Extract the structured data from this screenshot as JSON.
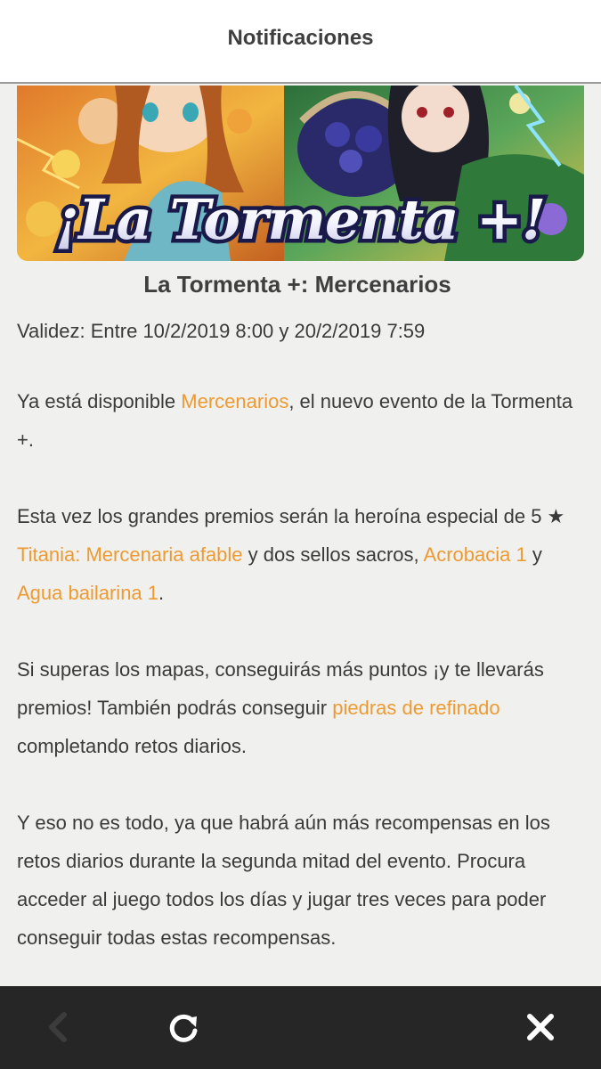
{
  "header": {
    "title": "Notificaciones"
  },
  "banner": {
    "text": "¡La Tormenta +!"
  },
  "article": {
    "title": "La Tormenta +: Mercenarios",
    "validity": "Validez: Entre 10/2/2019 8:00 y 20/2/2019 7:59",
    "p1": {
      "t1": "Ya está disponible ",
      "link_mercenarios": "Mercenarios",
      "t2": ", el nuevo evento de la Tormenta +."
    },
    "p2": {
      "t1": "Esta vez los grandes premios serán la heroína especial de 5 ★ ",
      "link_titania": "Titania: Mercenaria afable",
      "t2": " y dos sellos sacros, ",
      "link_acrobacia": "Acrobacia 1",
      "t3": " y ",
      "link_agua": "Agua bailarina 1",
      "t4": "."
    },
    "p3": {
      "t1": "Si superas los mapas, conseguirás más puntos ¡y te llevarás premios! También podrás conseguir ",
      "link_piedras": "piedras de refinado",
      "t2": " completando retos diarios."
    },
    "p4": {
      "t1": "Y eso no es todo, ya que habrá aún más recompensas en los retos diarios durante la segunda mitad del evento. Procura acceder al juego todos los días y jugar tres veces para poder conseguir todas estas recompensas."
    }
  },
  "footer": {
    "back_icon": "back-arrow-icon",
    "reload_icon": "reload-icon",
    "close_icon": "close-icon"
  },
  "colors": {
    "link": "#ee9a32",
    "background": "#f0f1ef",
    "footer": "#262626"
  }
}
